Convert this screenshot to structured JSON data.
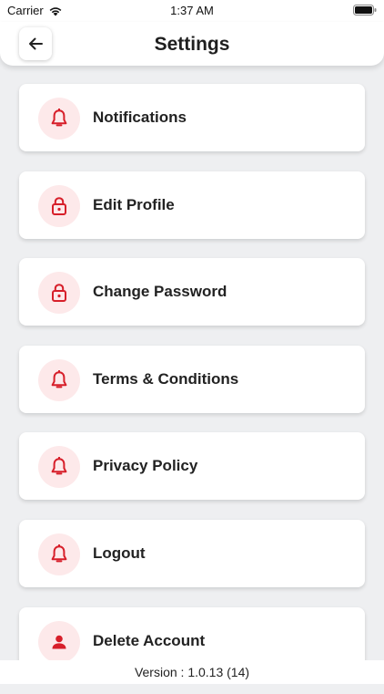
{
  "status_bar": {
    "carrier": "Carrier",
    "time": "1:37 AM"
  },
  "header": {
    "title": "Settings",
    "back_icon": "arrow-left-icon"
  },
  "accent_color": "#d71f2a",
  "icon_bg_color": "#fde9ea",
  "items": [
    {
      "label": "Notifications",
      "icon": "bell-icon"
    },
    {
      "label": "Edit Profile",
      "icon": "lock-icon"
    },
    {
      "label": "Change Password",
      "icon": "lock-icon"
    },
    {
      "label": "Terms & Conditions",
      "icon": "bell-icon"
    },
    {
      "label": "Privacy Policy",
      "icon": "bell-icon"
    },
    {
      "label": "Logout",
      "icon": "bell-icon"
    },
    {
      "label": "Delete Account",
      "icon": "person-icon"
    }
  ],
  "footer": {
    "version": "Version : 1.0.13 (14)"
  }
}
